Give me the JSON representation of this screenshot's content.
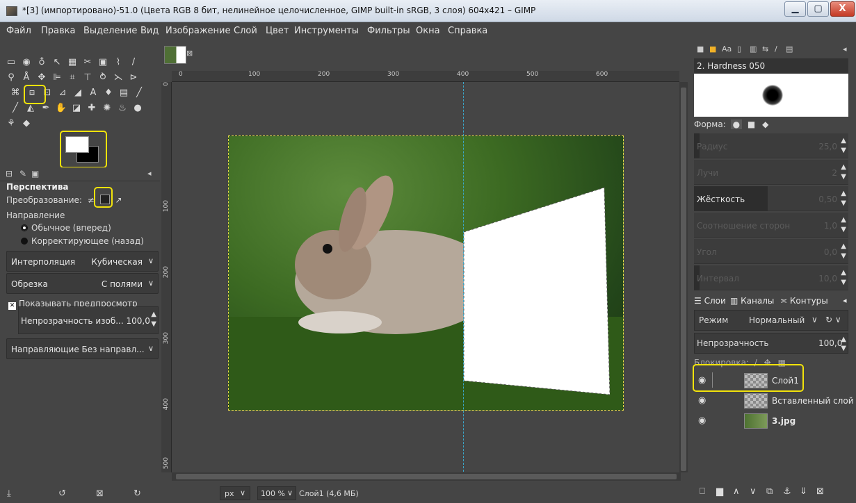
{
  "window": {
    "title": "*[3] (импортировано)-51.0 (Цвета RGB 8 бит, нелинейное целочисленное, GIMP built-in sRGB, 3 слоя) 604x421 – GIMP",
    "min": "▁",
    "max": "▢",
    "close": "X"
  },
  "menu": [
    "Файл",
    "Правка",
    "Выделение",
    "Вид",
    "Изображение",
    "Слой",
    "Цвет",
    "Инструменты",
    "Фильтры",
    "Окна",
    "Справка"
  ],
  "tool_options": {
    "title": "Перспектива",
    "transform_label": "Преобразование:",
    "direction_label": "Направление",
    "direction_normal": "Обычное (вперед)",
    "direction_corrective": "Корректирующее (назад)",
    "interpolation_label": "Интерполяция",
    "interpolation_value": "Кубическая",
    "clipping_label": "Обрезка",
    "clipping_value": "С полями",
    "show_preview": "Показывать предпросмотр",
    "image_opacity": "Непрозрачность изоб... 100,0",
    "guides_label": "Направляющие Без направл..."
  },
  "ruler": {
    "h": [
      "0",
      "100",
      "200",
      "300",
      "400",
      "500",
      "600"
    ],
    "v": [
      "0",
      "100",
      "200",
      "300",
      "400",
      "500"
    ]
  },
  "status": {
    "unit": "px",
    "zoom": "100 %",
    "layer_info": "Слой1 (4,6 МБ)"
  },
  "brushes": {
    "name": "2. Hardness 050",
    "shape_label": "Форма:",
    "params": [
      {
        "label": "Радиус",
        "value": "25,0",
        "active": false
      },
      {
        "label": "Лучи",
        "value": "2",
        "active": false
      },
      {
        "label": "Жёсткость",
        "value": "0,50",
        "active": true
      },
      {
        "label": "Соотношение сторон",
        "value": "1,0",
        "active": false
      },
      {
        "label": "Угол",
        "value": "0,0",
        "active": false
      },
      {
        "label": "Интервал",
        "value": "10,0",
        "active": false
      }
    ]
  },
  "layers": {
    "tabs": [
      "Слои",
      "Каналы",
      "Контуры"
    ],
    "mode_label": "Режим",
    "mode_value": "Нормальный",
    "opacity_label": "Непрозрачность",
    "opacity_value": "100,0",
    "lock_label": "Блокировка:",
    "items": [
      {
        "name": "Слой1",
        "bold": false
      },
      {
        "name": "Вставленный слой",
        "bold": false
      },
      {
        "name": "3.jpg",
        "bold": true
      }
    ]
  },
  "colors": {
    "highlight": "#f2e30b",
    "guide": "#3aa7c9",
    "selection": "#e8d84a"
  }
}
